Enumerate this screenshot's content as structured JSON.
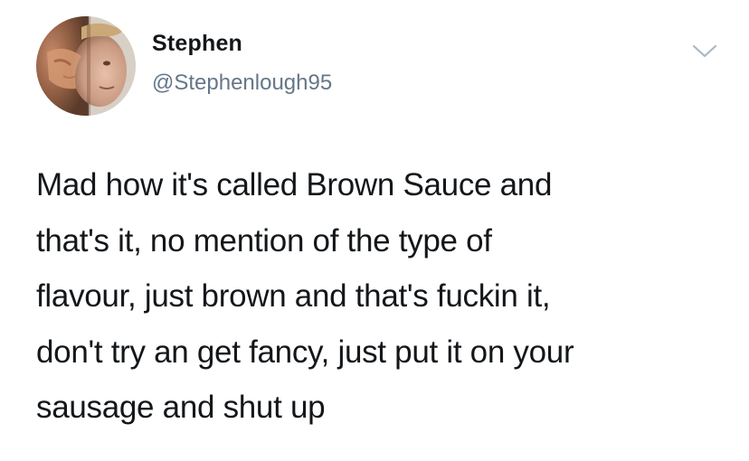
{
  "tweet": {
    "author": {
      "display_name": "Stephen",
      "handle": "@Stephenlough95",
      "avatar": "user-avatar"
    },
    "menu_icon": "chevron-down-icon",
    "text_lines": [
      "Mad how it's called Brown Sauce and",
      "that's it, no mention of the type of",
      "flavour, just brown and that's fuckin it,",
      "don't try an get fancy, just put it on your",
      "sausage and shut up"
    ]
  },
  "colors": {
    "text_primary": "#14171a",
    "text_secondary": "#657786",
    "caret": "#aab8c2",
    "background": "#ffffff"
  }
}
